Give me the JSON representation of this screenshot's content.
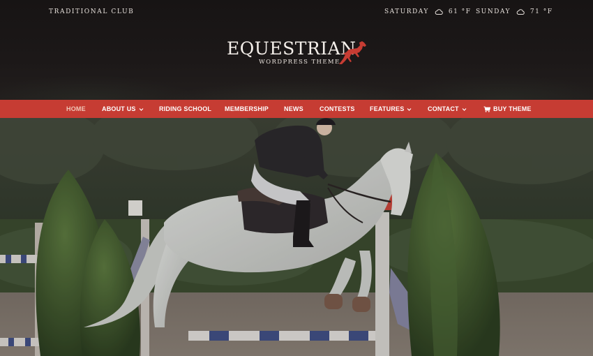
{
  "topbar": {
    "club": "TRADITIONAL CLUB",
    "weather": [
      {
        "day": "SATURDAY",
        "temp": "61 °F",
        "icon": "cloud-icon"
      },
      {
        "day": "SUNDAY",
        "temp": "71 °F",
        "icon": "cloud-icon"
      }
    ]
  },
  "logo": {
    "title": "EQUESTRIAN",
    "subtitle": "WORDPRESS THEME",
    "icon": "horse-icon",
    "accent": "#c63c33"
  },
  "nav": {
    "items": [
      {
        "label": "HOME",
        "active": true
      },
      {
        "label": "ABOUT US",
        "dropdown": true
      },
      {
        "label": "RIDING SCHOOL"
      },
      {
        "label": "MEMBERSHIP"
      },
      {
        "label": "NEWS"
      },
      {
        "label": "CONTESTS"
      },
      {
        "label": "FEATURES",
        "dropdown": true
      },
      {
        "label": "CONTACT",
        "dropdown": true
      },
      {
        "label": "BUY THEME",
        "icon": "cart-icon"
      }
    ],
    "bar_color": "#c63c33"
  }
}
